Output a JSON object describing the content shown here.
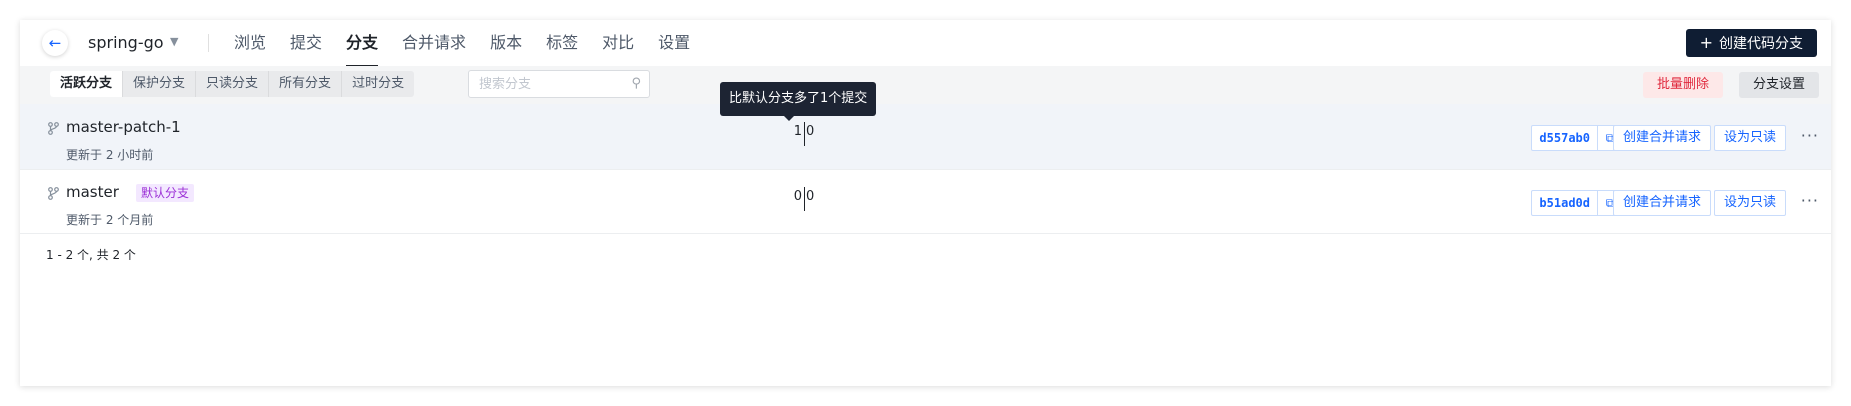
{
  "header": {
    "back_icon": "arrow-left-icon",
    "repo_name": "spring-go",
    "nav": [
      "浏览",
      "提交",
      "分支",
      "合并请求",
      "版本",
      "标签",
      "对比",
      "设置"
    ],
    "active_nav": "分支",
    "create_button": "创建代码分支"
  },
  "filters": {
    "tabs": [
      "活跃分支",
      "保护分支",
      "只读分支",
      "所有分支",
      "过时分支"
    ],
    "active_tab": "活跃分支",
    "search_placeholder": "搜索分支",
    "bulk_delete": "批量删除",
    "branch_settings": "分支设置"
  },
  "branches": [
    {
      "name": "master-patch-1",
      "badge": "",
      "updated": "更新于 2 小时前",
      "behind": "1",
      "ahead": "0",
      "sha": "d557ab0",
      "create_mr": "创建合并请求",
      "set_readonly": "设为只读"
    },
    {
      "name": "master",
      "badge": "默认分支",
      "updated": "更新于 2 个月前",
      "behind": "0",
      "ahead": "0",
      "sha": "b51ad0d",
      "create_mr": "创建合并请求",
      "set_readonly": "设为只读"
    }
  ],
  "pagination": "1 - 2 个,  共 2 个",
  "tooltip": "比默认分支多了1个提交",
  "colors": {
    "accent": "#1664ff",
    "primary_dark": "#0f1d33",
    "danger": "#e0293d",
    "badge_bg": "#f3e8ff",
    "badge_fg": "#9b2fd6"
  }
}
